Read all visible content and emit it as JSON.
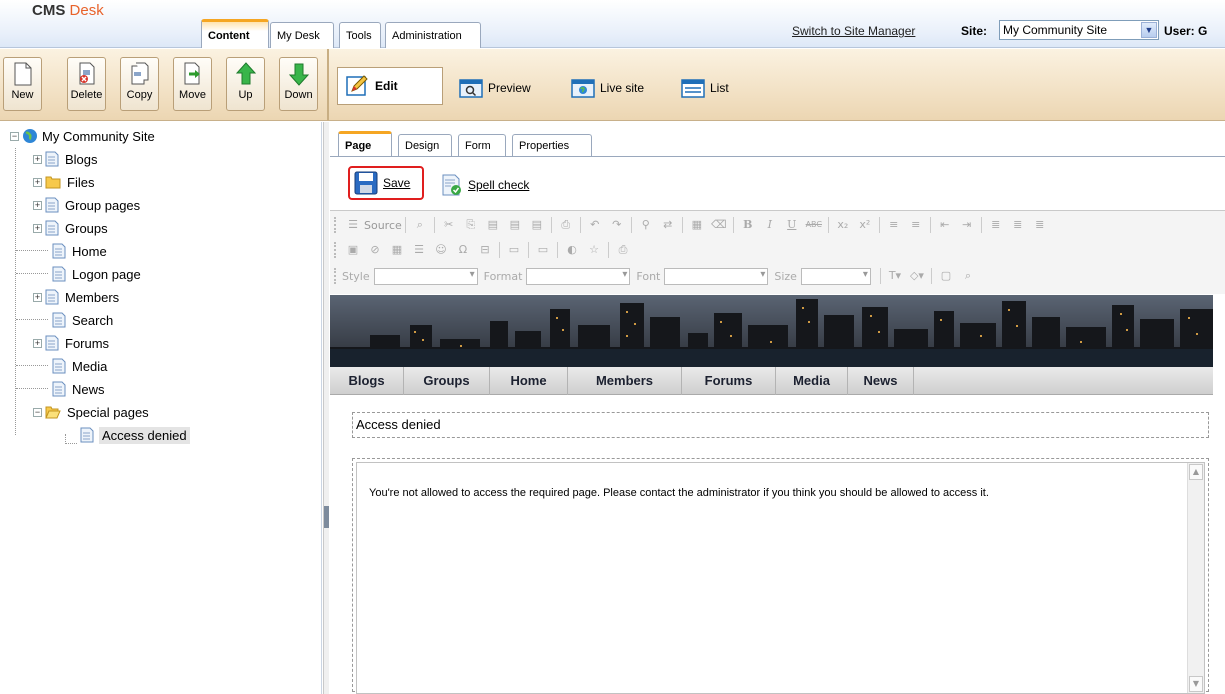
{
  "header": {
    "logo_cms": "CMS",
    "logo_desk": "Desk",
    "tabs": [
      "Content",
      "My Desk",
      "Tools",
      "Administration"
    ],
    "switch_link": "Switch to Site Manager",
    "site_label": "Site:",
    "site_value": "My Community Site",
    "user_label": "User: G"
  },
  "toolbar": {
    "buttons": [
      "New",
      "Delete",
      "Copy",
      "Move",
      "Up",
      "Down"
    ],
    "views": [
      "Edit",
      "Preview",
      "Live site",
      "List"
    ]
  },
  "tree": {
    "root": "My Community Site",
    "items": [
      "Blogs",
      "Files",
      "Group pages",
      "Groups",
      "Home",
      "Logon page",
      "Members",
      "Search",
      "Forums",
      "Media",
      "News",
      "Special pages"
    ],
    "child": "Access denied"
  },
  "subtabs": [
    "Page",
    "Design",
    "Form",
    "Properties"
  ],
  "actions": {
    "save": "Save",
    "spell": "Spell check"
  },
  "editor": {
    "source_label": "Source",
    "style_label": "Style",
    "format_label": "Format",
    "font_label": "Font",
    "size_label": "Size"
  },
  "page": {
    "nav": [
      "Blogs",
      "Groups",
      "Home",
      "Members",
      "Forums",
      "Media",
      "News"
    ],
    "title_value": "Access denied",
    "body_text": "You're not allowed to access the required page. Please contact the administrator if you think you should be allowed to access it."
  },
  "colors": {
    "accent": "#f5a623",
    "highlight_border": "#e01e1e",
    "logo_desk": "#e8622a"
  }
}
